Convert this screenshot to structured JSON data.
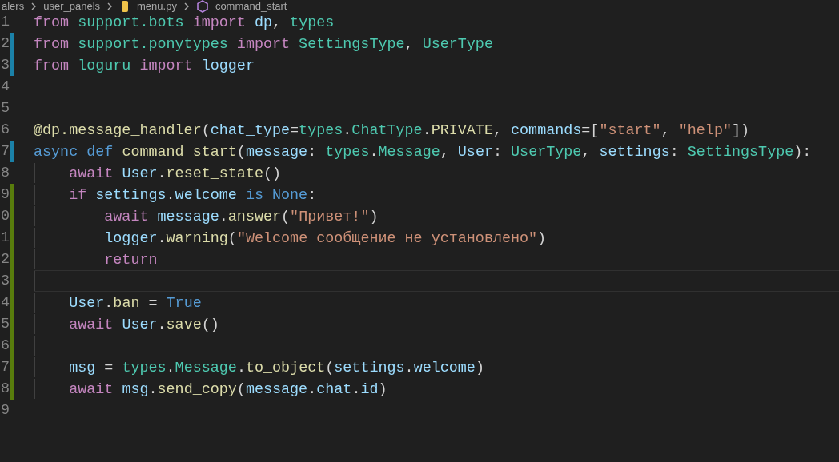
{
  "breadcrumb": [
    {
      "text": "alers",
      "kind": "folder"
    },
    {
      "text": "user_panels",
      "kind": "folder"
    },
    {
      "text": "menu.py",
      "kind": "python"
    },
    {
      "text": "command_start",
      "kind": "function"
    }
  ],
  "lines": [
    {
      "number": "1",
      "modified": false,
      "added": false,
      "current": false,
      "tokens": [
        {
          "text": "from ",
          "kind": "keyword"
        },
        {
          "text": "support.bots ",
          "kind": "module"
        },
        {
          "text": "import ",
          "kind": "keyword"
        },
        {
          "text": "dp",
          "kind": "variable"
        },
        {
          "text": ", ",
          "kind": "plain"
        },
        {
          "text": "types",
          "kind": "module"
        }
      ]
    },
    {
      "number": "2",
      "modified": true,
      "added": false,
      "current": false,
      "tokens": [
        {
          "text": "from ",
          "kind": "keyword"
        },
        {
          "text": "support.ponytypes ",
          "kind": "module"
        },
        {
          "text": "import ",
          "kind": "keyword"
        },
        {
          "text": "SettingsType",
          "kind": "module"
        },
        {
          "text": ", ",
          "kind": "plain"
        },
        {
          "text": "UserType",
          "kind": "module"
        }
      ]
    },
    {
      "number": "3",
      "modified": true,
      "added": false,
      "current": false,
      "tokens": [
        {
          "text": "from ",
          "kind": "keyword"
        },
        {
          "text": "loguru ",
          "kind": "module"
        },
        {
          "text": "import ",
          "kind": "keyword"
        },
        {
          "text": "logger",
          "kind": "variable"
        }
      ]
    },
    {
      "number": "4",
      "modified": false,
      "added": false,
      "current": false
    },
    {
      "number": "5",
      "modified": false,
      "added": false,
      "current": false
    },
    {
      "number": "6",
      "modified": false,
      "added": false,
      "current": false,
      "tokens": [
        {
          "text": "@dp.message_handler",
          "kind": "function"
        },
        {
          "text": "(",
          "kind": "plain"
        },
        {
          "text": "chat_type",
          "kind": "variable"
        },
        {
          "text": "=",
          "kind": "plain"
        },
        {
          "text": "types",
          "kind": "module"
        },
        {
          "text": ".",
          "kind": "plain"
        },
        {
          "text": "ChatType",
          "kind": "module"
        },
        {
          "text": ".",
          "kind": "plain"
        },
        {
          "text": "PRIVATE",
          "kind": "function"
        },
        {
          "text": ", ",
          "kind": "plain"
        },
        {
          "text": "commands",
          "kind": "variable"
        },
        {
          "text": "=[",
          "kind": "plain"
        },
        {
          "text": "\"start\"",
          "kind": "string"
        },
        {
          "text": ", ",
          "kind": "plain"
        },
        {
          "text": "\"help\"",
          "kind": "string"
        },
        {
          "text": "])",
          "kind": "plain"
        }
      ]
    },
    {
      "number": "7",
      "modified": true,
      "added": false,
      "current": false,
      "tokens": [
        {
          "text": "async def ",
          "kind": "storage"
        },
        {
          "text": "command_start",
          "kind": "function"
        },
        {
          "text": "(",
          "kind": "plain"
        },
        {
          "text": "message",
          "kind": "variable"
        },
        {
          "text": ": ",
          "kind": "plain"
        },
        {
          "text": "types",
          "kind": "module"
        },
        {
          "text": ".",
          "kind": "plain"
        },
        {
          "text": "Message",
          "kind": "module"
        },
        {
          "text": ", ",
          "kind": "plain"
        },
        {
          "text": "User",
          "kind": "variable"
        },
        {
          "text": ": ",
          "kind": "plain"
        },
        {
          "text": "UserType",
          "kind": "module"
        },
        {
          "text": ", ",
          "kind": "plain"
        },
        {
          "text": "settings",
          "kind": "variable"
        },
        {
          "text": ": ",
          "kind": "plain"
        },
        {
          "text": "SettingsType",
          "kind": "module"
        },
        {
          "text": "):",
          "kind": "plain"
        }
      ]
    },
    {
      "number": "8",
      "modified": false,
      "added": false,
      "current": false,
      "tokens": [
        {
          "text": "    await ",
          "kind": "keyword"
        },
        {
          "text": "User",
          "kind": "variable"
        },
        {
          "text": ".",
          "kind": "plain"
        },
        {
          "text": "reset_state",
          "kind": "function"
        },
        {
          "text": "()",
          "kind": "plain"
        }
      ]
    },
    {
      "number": "9",
      "modified": false,
      "added": true,
      "current": false,
      "tokens": [
        {
          "text": "    if ",
          "kind": "keyword"
        },
        {
          "text": "settings",
          "kind": "variable"
        },
        {
          "text": ".",
          "kind": "plain"
        },
        {
          "text": "welcome ",
          "kind": "variable"
        },
        {
          "text": "is None",
          "kind": "storage"
        },
        {
          "text": ":",
          "kind": "plain"
        }
      ]
    },
    {
      "number": "0",
      "modified": false,
      "added": true,
      "current": false,
      "tokens": [
        {
          "text": "        await ",
          "kind": "keyword"
        },
        {
          "text": "message",
          "kind": "variable"
        },
        {
          "text": ".",
          "kind": "plain"
        },
        {
          "text": "answer",
          "kind": "function"
        },
        {
          "text": "(",
          "kind": "plain"
        },
        {
          "text": "\"Привет!\"",
          "kind": "string"
        },
        {
          "text": ")",
          "kind": "plain"
        }
      ]
    },
    {
      "number": "1",
      "modified": false,
      "added": true,
      "current": false,
      "tokens": [
        {
          "text": "        logger",
          "kind": "variable"
        },
        {
          "text": ".",
          "kind": "plain"
        },
        {
          "text": "warning",
          "kind": "function"
        },
        {
          "text": "(",
          "kind": "plain"
        },
        {
          "text": "\"Welcome сообщение не установлено\"",
          "kind": "string"
        },
        {
          "text": ")",
          "kind": "plain"
        }
      ]
    },
    {
      "number": "2",
      "modified": false,
      "added": true,
      "current": false,
      "tokens": [
        {
          "text": "        return",
          "kind": "keyword"
        }
      ]
    },
    {
      "number": "3",
      "modified": false,
      "added": true,
      "current": true
    },
    {
      "number": "4",
      "modified": false,
      "added": true,
      "current": false,
      "tokens": [
        {
          "text": "    User",
          "kind": "variable"
        },
        {
          "text": ".",
          "kind": "plain"
        },
        {
          "text": "ban",
          "kind": "function"
        },
        {
          "text": " = ",
          "kind": "plain"
        },
        {
          "text": "True",
          "kind": "storage"
        }
      ]
    },
    {
      "number": "5",
      "modified": false,
      "added": true,
      "current": false,
      "tokens": [
        {
          "text": "    await ",
          "kind": "keyword"
        },
        {
          "text": "User",
          "kind": "variable"
        },
        {
          "text": ".",
          "kind": "plain"
        },
        {
          "text": "save",
          "kind": "function"
        },
        {
          "text": "()",
          "kind": "plain"
        }
      ]
    },
    {
      "number": "6",
      "modified": false,
      "added": true,
      "current": false
    },
    {
      "number": "7",
      "modified": false,
      "added": true,
      "current": false,
      "tokens": [
        {
          "text": "    msg",
          "kind": "variable"
        },
        {
          "text": " = ",
          "kind": "plain"
        },
        {
          "text": "types",
          "kind": "module"
        },
        {
          "text": ".",
          "kind": "plain"
        },
        {
          "text": "Message",
          "kind": "module"
        },
        {
          "text": ".",
          "kind": "plain"
        },
        {
          "text": "to_object",
          "kind": "function"
        },
        {
          "text": "(",
          "kind": "plain"
        },
        {
          "text": "settings",
          "kind": "variable"
        },
        {
          "text": ".",
          "kind": "plain"
        },
        {
          "text": "welcome",
          "kind": "variable"
        },
        {
          "text": ")",
          "kind": "plain"
        }
      ]
    },
    {
      "number": "8",
      "modified": false,
      "added": true,
      "current": false,
      "tokens": [
        {
          "text": "    await ",
          "kind": "keyword"
        },
        {
          "text": "msg",
          "kind": "variable"
        },
        {
          "text": ".",
          "kind": "plain"
        },
        {
          "text": "send_copy",
          "kind": "function"
        },
        {
          "text": "(",
          "kind": "plain"
        },
        {
          "text": "message",
          "kind": "variable"
        },
        {
          "text": ".",
          "kind": "plain"
        },
        {
          "text": "chat",
          "kind": "variable"
        },
        {
          "text": ".",
          "kind": "plain"
        },
        {
          "text": "id",
          "kind": "variable"
        },
        {
          "text": ")",
          "kind": "plain"
        }
      ]
    },
    {
      "number": "9",
      "modified": false,
      "added": false,
      "current": false
    }
  ]
}
